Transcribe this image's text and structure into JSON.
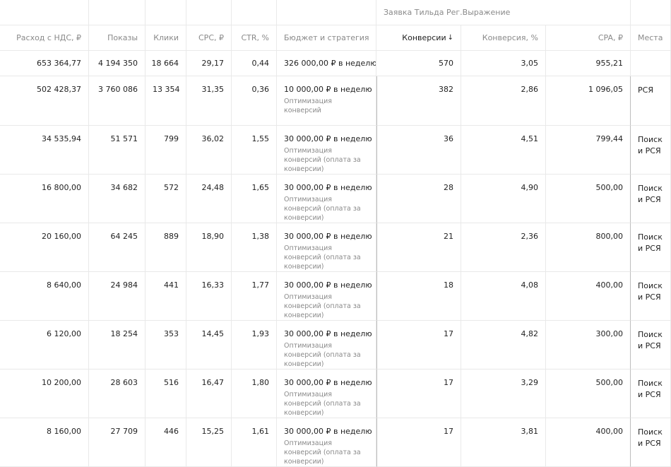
{
  "group_header": "Заявка Тильда Рег.Выражение",
  "columns": {
    "spend": "Расход с НДС, ₽",
    "impressions": "Показы",
    "clicks": "Клики",
    "cpc": "CPC, ₽",
    "ctr": "CTR, %",
    "budget": "Бюджет и стратегия",
    "conversions": "Конверсии",
    "conv_rate": "Конверсия, %",
    "cpa": "CPA, ₽",
    "places": "Места"
  },
  "sort_indicator": "↓",
  "totals": {
    "spend": "653 364,77",
    "impressions": "4 194 350",
    "clicks": "18 664",
    "cpc": "29,17",
    "ctr": "0,44",
    "budget": "326 000,00 ₽ в неделю",
    "conversions": "570",
    "conv_rate": "3,05",
    "cpa": "955,21"
  },
  "rows": [
    {
      "spend": "502 428,37",
      "impressions": "3 760 086",
      "clicks": "13 354",
      "cpc": "31,35",
      "ctr": "0,36",
      "budget": "10 000,00 ₽ в неделю",
      "strategy": "Оптимизация конверсий",
      "conversions": "382",
      "conv_rate": "2,86",
      "cpa": "1 096,05",
      "places": "РСЯ"
    },
    {
      "spend": "34 535,94",
      "impressions": "51 571",
      "clicks": "799",
      "cpc": "36,02",
      "ctr": "1,55",
      "budget": "30 000,00 ₽ в неделю",
      "strategy": "Оптимизация конверсий (оплата за конверсии)",
      "conversions": "36",
      "conv_rate": "4,51",
      "cpa": "799,44",
      "places": "Поиск и РСЯ"
    },
    {
      "spend": "16 800,00",
      "impressions": "34 682",
      "clicks": "572",
      "cpc": "24,48",
      "ctr": "1,65",
      "budget": "30 000,00 ₽ в неделю",
      "strategy": "Оптимизация конверсий (оплата за конверсии)",
      "conversions": "28",
      "conv_rate": "4,90",
      "cpa": "500,00",
      "places": "Поиск и РСЯ"
    },
    {
      "spend": "20 160,00",
      "impressions": "64 245",
      "clicks": "889",
      "cpc": "18,90",
      "ctr": "1,38",
      "budget": "30 000,00 ₽ в неделю",
      "strategy": "Оптимизация конверсий (оплата за конверсии)",
      "conversions": "21",
      "conv_rate": "2,36",
      "cpa": "800,00",
      "places": "Поиск и РСЯ"
    },
    {
      "spend": "8 640,00",
      "impressions": "24 984",
      "clicks": "441",
      "cpc": "16,33",
      "ctr": "1,77",
      "budget": "30 000,00 ₽ в неделю",
      "strategy": "Оптимизация конверсий (оплата за конверсии)",
      "conversions": "18",
      "conv_rate": "4,08",
      "cpa": "400,00",
      "places": "Поиск и РСЯ"
    },
    {
      "spend": "6 120,00",
      "impressions": "18 254",
      "clicks": "353",
      "cpc": "14,45",
      "ctr": "1,93",
      "budget": "30 000,00 ₽ в неделю",
      "strategy": "Оптимизация конверсий (оплата за конверсии)",
      "conversions": "17",
      "conv_rate": "4,82",
      "cpa": "300,00",
      "places": "Поиск и РСЯ"
    },
    {
      "spend": "10 200,00",
      "impressions": "28 603",
      "clicks": "516",
      "cpc": "16,47",
      "ctr": "1,80",
      "budget": "30 000,00 ₽ в неделю",
      "strategy": "Оптимизация конверсий (оплата за конверсии)",
      "conversions": "17",
      "conv_rate": "3,29",
      "cpa": "500,00",
      "places": "Поиск и РСЯ"
    },
    {
      "spend": "8 160,00",
      "impressions": "27 709",
      "clicks": "446",
      "cpc": "15,25",
      "ctr": "1,61",
      "budget": "30 000,00 ₽ в неделю",
      "strategy": "Оптимизация конверсий (оплата за конверсии)",
      "conversions": "17",
      "conv_rate": "3,81",
      "cpa": "400,00",
      "places": "Поиск и РСЯ"
    }
  ]
}
